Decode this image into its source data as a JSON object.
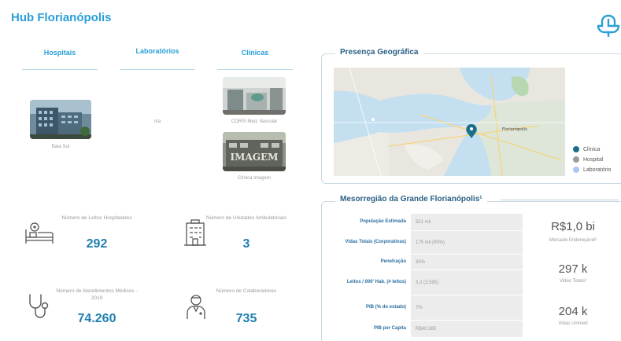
{
  "header": {
    "title": "Hub Florianópolis"
  },
  "columns": {
    "hospitals": {
      "label": "Hospitais",
      "items": [
        {
          "caption": "Baia Sul"
        }
      ]
    },
    "labs": {
      "label": "Laboratórios",
      "empty_text": "n/a"
    },
    "clinics": {
      "label": "Clínicas",
      "items": [
        {
          "caption": "CORIS Med. Vascular"
        },
        {
          "caption": "Clínica Imagem"
        }
      ]
    }
  },
  "kpis": [
    {
      "label": "Número de Leitos Hospitalares",
      "value": "292",
      "icon": "hospital-bed-icon"
    },
    {
      "label": "Número de Unidades Ambulatoriais",
      "value": "3",
      "icon": "building-icon"
    },
    {
      "label": "Número de Atendimentos Médicos - 2019",
      "value": "74.260",
      "icon": "stethoscope-icon"
    },
    {
      "label": "Número de Colaboradores",
      "value": "735",
      "icon": "doctor-icon"
    }
  ],
  "geo": {
    "title": "Presença Geográfica",
    "map_label": "Florianópolis",
    "legend": [
      {
        "label": "Clínica",
        "color": "#1a6f8a"
      },
      {
        "label": "Hospital",
        "color": "#9a9a9a"
      },
      {
        "label": "Laboratório",
        "color": "#a9c8f0"
      }
    ]
  },
  "meso": {
    "title": "Mesorregião da Grande Florianópolis¹",
    "rows": [
      {
        "key": "População Estimada",
        "value": "501 mil"
      },
      {
        "key": "Vidas Totais (Corporativas)",
        "value": "175 mil (95%)"
      },
      {
        "key": "Penetração",
        "value": "35%"
      },
      {
        "key": "Leitos / 000' Hab. (# leitos)",
        "value": "3,2 (3.595)"
      },
      {
        "key": "PIB (% do estado)",
        "value": "7%"
      },
      {
        "key": "PIB per Capita",
        "value": "R$40.385"
      }
    ],
    "stats": [
      {
        "value": "R$1,0 bi",
        "label": "Mercado Endereçável²"
      },
      {
        "value": "297 k",
        "label": "Vidas Totais³"
      },
      {
        "value": "204 k",
        "label": "Vidas Unimed"
      }
    ]
  }
}
